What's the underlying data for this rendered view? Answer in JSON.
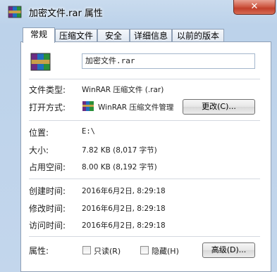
{
  "window": {
    "title": "加密文件.rar 属性",
    "close_glyph": "✕"
  },
  "tabs": [
    {
      "label": "常规"
    },
    {
      "label": "压缩文件"
    },
    {
      "label": "安全"
    },
    {
      "label": "详细信息"
    },
    {
      "label": "以前的版本"
    }
  ],
  "general": {
    "file_name": "加密文件.rar",
    "type_label": "文件类型:",
    "type_value": "WinRAR 压缩文件 (.rar)",
    "opens_with_label": "打开方式:",
    "opens_with_value": "WinRAR 压缩文件管理",
    "change_button": "更改(C)...",
    "location_label": "位置:",
    "location_value": "E:\\",
    "size_label": "大小:",
    "size_value": "7.82 KB (8,017 字节)",
    "size_on_disk_label": "占用空间:",
    "size_on_disk_value": "8.00 KB (8,192 字节)",
    "created_label": "创建时间:",
    "created_value": "2016年6月2日, 8:29:18",
    "modified_label": "修改时间:",
    "modified_value": "2016年6月2日, 8:29:18",
    "accessed_label": "访问时间:",
    "accessed_value": "2016年6月2日, 8:29:18",
    "attributes_label": "属性:",
    "readonly_label": "只读(R)",
    "readonly_checked": false,
    "hidden_label": "隐藏(H)",
    "hidden_checked": false,
    "advanced_button": "高级(D)..."
  },
  "icons": {
    "title": "winrar-archive-icon",
    "file": "winrar-archive-icon",
    "opens_with": "winrar-app-icon"
  },
  "colors": {
    "window_frame": "#bcd2ea",
    "tab_border": "#8e9fb5",
    "close_button": "#c2402b"
  }
}
